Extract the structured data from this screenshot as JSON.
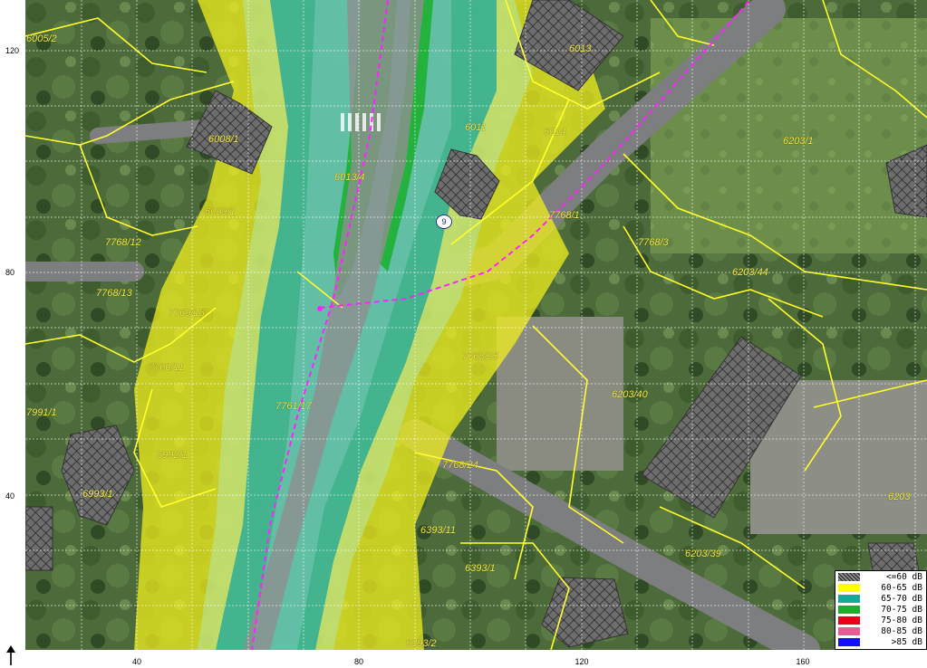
{
  "axes": {
    "y_ticks": [
      "120",
      "80",
      "40"
    ],
    "x_ticks": [
      "40",
      "80",
      "120",
      "160"
    ]
  },
  "parcels": [
    "6005/2",
    "6008/1",
    "6009/1",
    "7768/12",
    "7768/13",
    "7769/16",
    "7760/11",
    "7991/1",
    "5992/1",
    "6993/1",
    "6013/4",
    "6011",
    "6013",
    "6014",
    "7768/1",
    "6203/1",
    "7768/3",
    "6203/44",
    "7768/25",
    "6203/40",
    "6203/39",
    "6393/11",
    "6393/1",
    "6393/2",
    "7768/24",
    "6203",
    "7761/17"
  ],
  "marker": {
    "label": "9"
  },
  "legend": [
    {
      "label": "<=60 dB",
      "color": "#8a8a8a",
      "pattern": "crosshatch"
    },
    {
      "label": "60-65 dB",
      "color": "#ffff00"
    },
    {
      "label": "65-70 dB",
      "color": "#1aa79a"
    },
    {
      "label": "70-75 dB",
      "color": "#1aaf2c"
    },
    {
      "label": "75-80 dB",
      "color": "#e8001a"
    },
    {
      "label": "80-85 dB",
      "color": "#ec5a94"
    },
    {
      "label": ">85 dB",
      "color": "#1010f0"
    }
  ],
  "colors": {
    "parcel_line": "#ffff2a",
    "grid": "#ffffff",
    "road": "#7d7e7f",
    "route": "#ff22ff",
    "building_hatch": "#222222"
  },
  "icons": {
    "north": "north-arrow-icon"
  }
}
